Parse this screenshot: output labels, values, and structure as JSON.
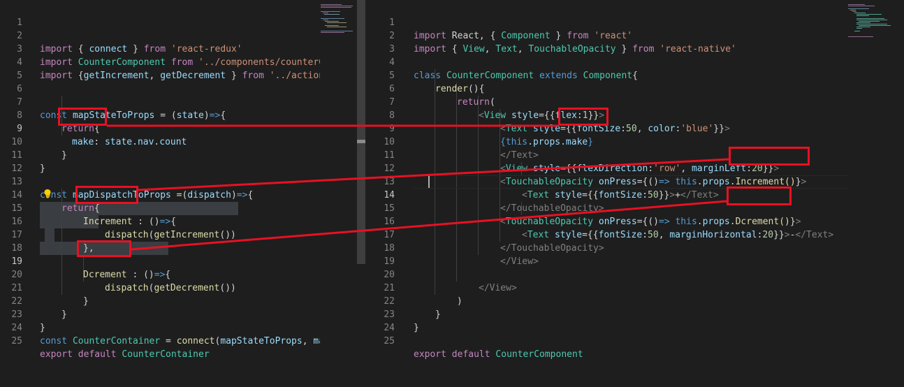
{
  "left_editor": {
    "lines": [
      {
        "n": "1"
      },
      {
        "n": "2"
      },
      {
        "n": "3"
      },
      {
        "n": "4"
      },
      {
        "n": "5"
      },
      {
        "n": "6"
      },
      {
        "n": "7"
      },
      {
        "n": "8"
      },
      {
        "n": "9"
      },
      {
        "n": "10"
      },
      {
        "n": "11"
      },
      {
        "n": "12"
      },
      {
        "n": "13"
      },
      {
        "n": "14"
      },
      {
        "n": "15"
      },
      {
        "n": "16"
      },
      {
        "n": "17"
      },
      {
        "n": "18"
      },
      {
        "n": "19"
      },
      {
        "n": "20"
      },
      {
        "n": "21"
      },
      {
        "n": "22"
      },
      {
        "n": "23"
      },
      {
        "n": "24"
      },
      {
        "n": "25"
      }
    ],
    "t": {
      "l2_import": "import",
      "l2_a": " { ",
      "l2_id": "connect",
      "l2_b": " } ",
      "l2_from": "from",
      "l2_str": " 'react-redux'",
      "l3_import": "import",
      "l3_id": " CounterComponent ",
      "l3_from": "from",
      "l3_str": " '../components/counterC",
      "l4_import": "import",
      "l4_a": " {",
      "l4_id1": "getIncrement",
      "l4_b": ", ",
      "l4_id2": "getDecrement",
      "l4_c": " } ",
      "l4_from": "from",
      "l4_str": " '../action",
      "l7_const": "const",
      "l7_fn": " mapStateToProps",
      "l7_a": " = (",
      "l7_id": "state",
      "l7_b": ")",
      "l7_arrow": "=>",
      "l7_c": "{",
      "l8_ret": "return",
      "l8_a": "{",
      "l9_id": "make",
      "l9_a": ": ",
      "l9_b": "state",
      "l9_c": ".",
      "l9_d": "nav",
      "l9_e": ".",
      "l9_f": "count",
      "l10": "}",
      "l11": "}",
      "l13_const": "const",
      "l13_fn": " mapDispatchToProps",
      "l13_a": " =(",
      "l13_id": "dispatch",
      "l13_b": ")",
      "l13_arrow": "=>",
      "l13_c": "{",
      "l14_ret": "return",
      "l14_a": "{",
      "l15_fn": "Increment",
      "l15_a": " : ()",
      "l15_arrow": "=>",
      "l15_b": "{",
      "l16_fn": "dispatch",
      "l16_a": "(",
      "l16_fn2": "getIncrement",
      "l16_b": "())",
      "l17": "},",
      "l19_fn": "Dcrement",
      "l19_a": " : ()",
      "l19_arrow": "=>",
      "l19_b": "{",
      "l20_fn": "dispatch",
      "l20_a": "(",
      "l20_fn2": "getDecrement",
      "l20_b": "())",
      "l21": "}",
      "l22": "}",
      "l23": "}",
      "l24_const": "const",
      "l24_id": " CounterContainer",
      "l24_a": " = ",
      "l24_fn": "connect",
      "l24_b": "(",
      "l24_c": "mapStateToProps",
      "l24_d": ", ",
      "l24_e": "map",
      "l25_kw": "export",
      "l25_kw2": " default",
      "l25_id": " CounterContainer"
    }
  },
  "right_editor": {
    "lines": [
      {
        "n": "1"
      },
      {
        "n": "2"
      },
      {
        "n": "3"
      },
      {
        "n": "4"
      },
      {
        "n": "5"
      },
      {
        "n": "6"
      },
      {
        "n": "7"
      },
      {
        "n": "8"
      },
      {
        "n": "9"
      },
      {
        "n": "10"
      },
      {
        "n": "11"
      },
      {
        "n": "12"
      },
      {
        "n": "13"
      },
      {
        "n": "14"
      },
      {
        "n": "15"
      },
      {
        "n": "16"
      },
      {
        "n": "17"
      },
      {
        "n": "18"
      },
      {
        "n": "19"
      },
      {
        "n": "20"
      },
      {
        "n": "21"
      },
      {
        "n": "22"
      },
      {
        "n": "23"
      },
      {
        "n": "24"
      },
      {
        "n": "25"
      }
    ],
    "t": {
      "r1_import": "import",
      "r1_a": " React, { ",
      "r1_b": "Component",
      "r1_c": " } ",
      "r1_from": "from",
      "r1_str": " 'react'",
      "r2_import": "import",
      "r2_a": " { ",
      "r2_b": "View",
      "r2_c": ", ",
      "r2_d": "Text",
      "r2_e": ", ",
      "r2_f": "TouchableOpacity",
      "r2_g": " } ",
      "r2_from": "from",
      "r2_str": " 'react-native'",
      "r4_class": "class",
      "r4_a": " CounterComponent",
      "r4_ext": " extends",
      "r4_b": " Component",
      "r4_c": "{",
      "r5_fn": "render",
      "r5_a": "(){",
      "r6_ret": "return",
      "r6_a": "(",
      "r7_lt": "<",
      "r7_tag": "View",
      "r7_attr": " style",
      "r7_a": "={{",
      "r7_b": "flex",
      "r7_c": ":",
      "r7_num": "1",
      "r7_d": "}}",
      "r7_gt": ">",
      "r8_lt": "<",
      "r8_tag": "Text",
      "r8_attr": " style",
      "r8_a": "={{",
      "r8_b": "fontSize",
      "r8_c": ":",
      "r8_num": "50",
      "r8_d": ", ",
      "r8_e": "color",
      "r8_f": ":",
      "r8_str": "'blue'",
      "r8_g": "}}",
      "r8_gt": ">",
      "r9_a": "{",
      "r9_this": "this",
      "r9_b": ".props",
      "r9_c": ".make",
      "r9_d": "}",
      "r10": "</Text>",
      "r11_lt": "<",
      "r11_tag": "View",
      "r11_attr": " style",
      "r11_a": "={{",
      "r11_b": "flexDirection",
      "r11_c": ":",
      "r11_str": "'row'",
      "r11_d": ", ",
      "r11_e": "marginLeft",
      "r11_f": ":",
      "r11_num": "20",
      "r11_g": "}}",
      "r11_gt": ">",
      "r12_lt": "<",
      "r12_tag": "TouchableOpacity",
      "r12_attr": " onPress",
      "r12_a": "={()",
      "r12_arrow": "=>",
      "r12_this": " this",
      "r12_b": ".props",
      "r12_c": ".Increment()",
      "r12_d": "}",
      "r12_gt": ">",
      "r13_lt": "<",
      "r13_tag": "Text",
      "r13_attr": " style",
      "r13_a": "={{",
      "r13_b": "fontSize",
      "r13_c": ":",
      "r13_num": "50",
      "r13_d": "}}",
      "r13_gt": ">",
      "r13_e": "+",
      "r13_close": "</Text>",
      "r14": "</TouchableOpacity>",
      "r15_lt": "<",
      "r15_tag": "TouchableOpacity",
      "r15_attr": " onPress",
      "r15_a": "={()",
      "r15_arrow": "=>",
      "r15_this": " this",
      "r15_b": ".props",
      "r15_c": ".Dcrement()",
      "r15_d": "}",
      "r15_gt": ">",
      "r16_lt": "<",
      "r16_tag": "Text",
      "r16_attr": " style",
      "r16_a": "={{",
      "r16_b": "fontSize",
      "r16_c": ":",
      "r16_num": "50",
      "r16_d": ", ",
      "r16_e": "marginHorizontal",
      "r16_f": ":",
      "r16_num2": "20",
      "r16_g": "}}",
      "r16_gt": ">",
      "r16_h": "-",
      "r16_close": "</Text>",
      "r17": "</TouchableOpacity>",
      "r18": "</View>",
      "r20": "</View>",
      "r21": ")",
      "r22": "}",
      "r23": "}",
      "r25_kw": "export",
      "r25_kw2": " default",
      "r25_id": " CounterComponent"
    }
  },
  "colors": {
    "background": "#1e1e1e",
    "keyword": "#569cd6",
    "control": "#c586c0",
    "string": "#ce9178",
    "function": "#dcdcaa",
    "identifier": "#9cdcfe",
    "type": "#4ec9b0",
    "number": "#b5cea8",
    "annotation": "#e81123"
  },
  "icons": {
    "lightbulb": "lightbulb-icon"
  }
}
